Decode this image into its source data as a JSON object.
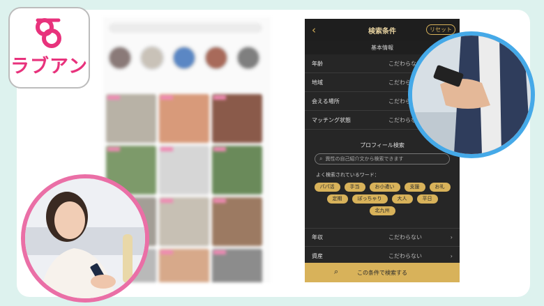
{
  "logo": {
    "text": "ラブアン"
  },
  "phone": {
    "back_icon": "‹",
    "title": "検索条件",
    "reset_label": "リセット",
    "basic_section": "基本情報",
    "basic_rows": [
      {
        "label": "年齢",
        "value": "こだわらない"
      },
      {
        "label": "地域",
        "value": "こだわらない"
      },
      {
        "label": "会える場所",
        "value": "こだわらない"
      },
      {
        "label": "マッチング状態",
        "value": "こだわらない"
      }
    ],
    "profile_title": "プロフィール検索",
    "search_placeholder": "異性の自己紹介文から検索できます",
    "keywords_title": "よく検索されているワード：",
    "keywords": [
      "パパ活",
      "手当",
      "お小遣い",
      "支援",
      "お礼",
      "定期",
      "ぽっちゃり",
      "大人",
      "平日",
      "北九州"
    ],
    "lower_rows": [
      {
        "label": "年収",
        "value": "こだわらない"
      },
      {
        "label": "資産",
        "value": "こだわらない"
      }
    ],
    "search_button": "この条件で検索する"
  },
  "colors": {
    "accent_gold": "#d8b25a",
    "brand_pink": "#e8327c",
    "circle_blue": "#45a9e8",
    "circle_pink": "#ea6fa6"
  }
}
